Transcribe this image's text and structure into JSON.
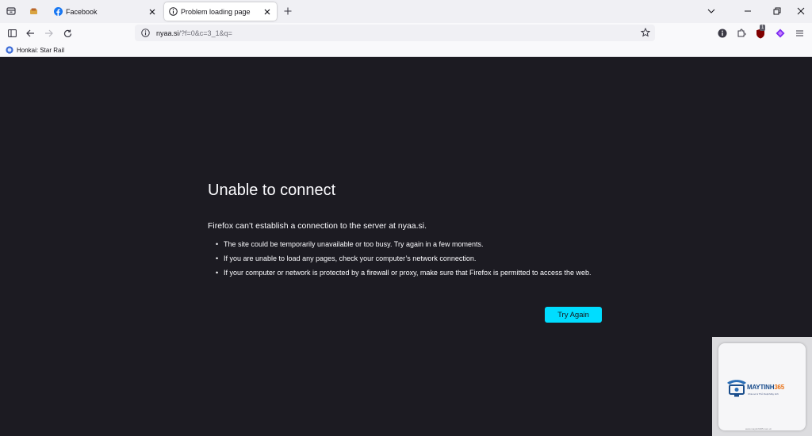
{
  "browser": {
    "tabs": [
      {
        "label": "Facebook",
        "icon": "facebook-icon",
        "active": false
      },
      {
        "label": "Problem loading page",
        "icon": "info-icon",
        "active": true
      }
    ],
    "url": {
      "host": "nyaa.si",
      "path": "/?f=0&c=3_1&q="
    },
    "bookmarks": [
      {
        "label": "Honkai: Star Rail",
        "icon": "honkai-icon"
      }
    ],
    "extension_badge": "1"
  },
  "error_page": {
    "title": "Unable to connect",
    "description": "Firefox can’t establish a connection to the server at nyaa.si.",
    "items": [
      "The site could be temporarily unavailable or too busy. Try again in a few moments.",
      "If you are unable to load any pages, check your computer’s network connection.",
      "If your computer or network is protected by a firewall or proxy, make sure that Firefox is permitted to access the web."
    ],
    "button_label": "Try Again"
  },
  "watermark": {
    "brand_part1": "MAYTINH",
    "brand_part2": "365",
    "tagline": "Chia sẻ & Thủ thuật Máy tính",
    "site": "www.maytinh365.com.vn"
  },
  "colors": {
    "content_bg": "#1c1b22",
    "accent_button": "#00ddff",
    "text_light": "#fbfbfe"
  }
}
